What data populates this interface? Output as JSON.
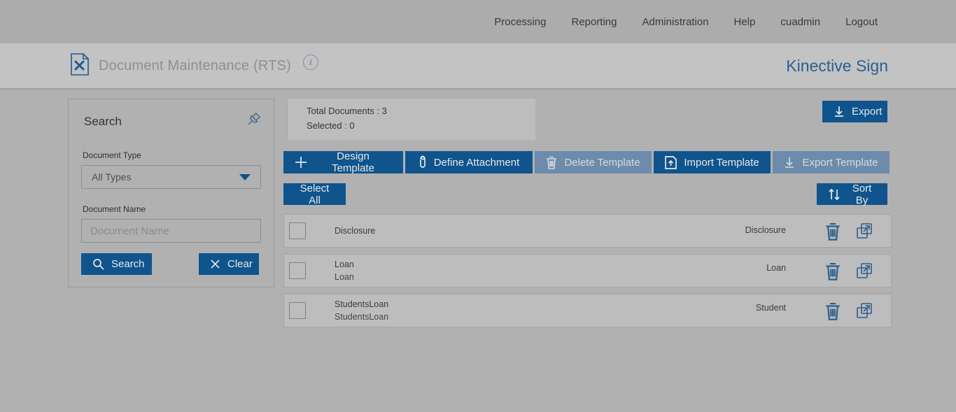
{
  "top_nav": {
    "items": [
      "Processing",
      "Reporting",
      "Administration",
      "Help",
      "cuadmin",
      "Logout"
    ]
  },
  "header": {
    "title": "Document Maintenance (RTS)",
    "info_icon": "i",
    "brand": "Kinective Sign"
  },
  "search_panel": {
    "title": "Search",
    "document_type_label": "Document Type",
    "document_type_value": "All Types",
    "document_name_label": "Document Name",
    "document_name_placeholder": "Document Name",
    "search_button": "Search",
    "clear_button": "Clear"
  },
  "summary": {
    "total_line": "Total Documents : 3",
    "selected_line": "Selected : 0"
  },
  "toolbar": {
    "export_label": "Export",
    "design_template_label": "Design Template",
    "define_attachment_label": "Define Attachment",
    "delete_template_label": "Delete Template",
    "import_template_label": "Import Template",
    "export_template_label": "Export Template",
    "select_all_label": "Select All",
    "sort_by_label": "Sort By"
  },
  "documents": [
    {
      "name": "Disclosure",
      "subtitle": "",
      "type": "Disclosure"
    },
    {
      "name": "Loan",
      "subtitle": "Loan",
      "type": "Loan"
    },
    {
      "name": "StudentsLoan",
      "subtitle": "StudentsLoan",
      "type": "Student"
    }
  ],
  "colors": {
    "primary_button": "#0f548c",
    "disabled_button": "#6d8cab",
    "brand_text": "#2a5f93",
    "page_background": "#b1b1b1"
  }
}
